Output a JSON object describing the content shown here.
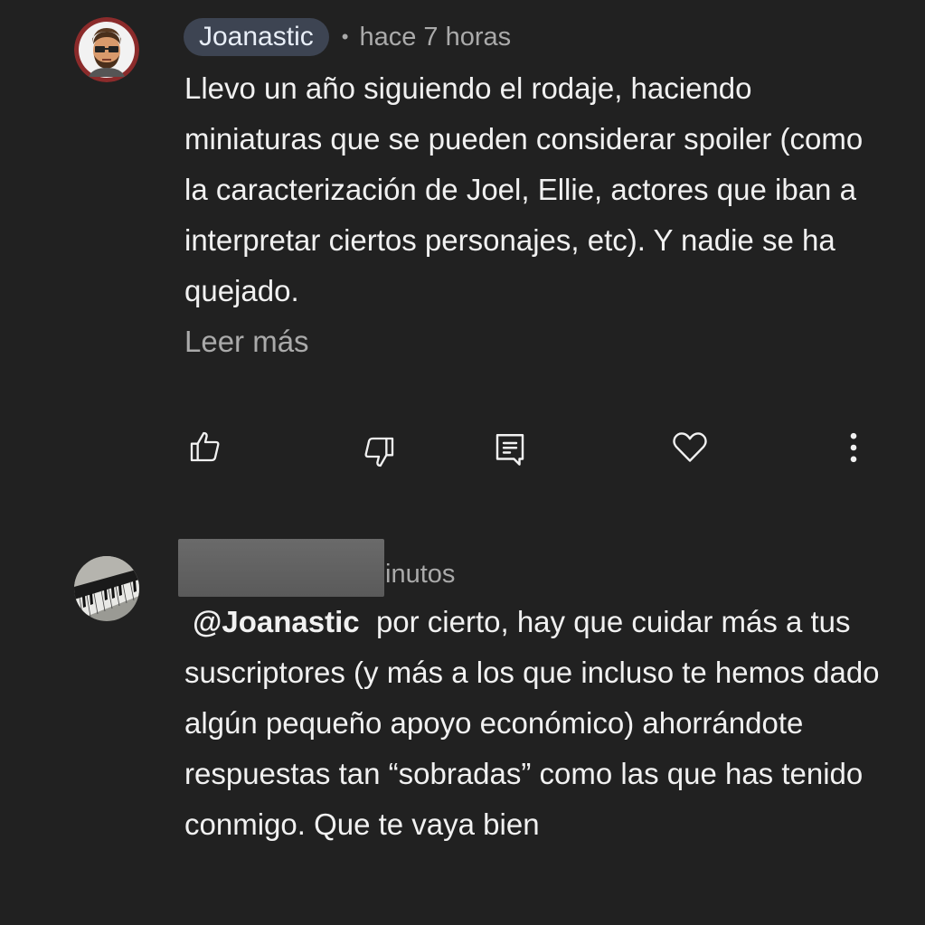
{
  "comments": [
    {
      "author": "Joanastic",
      "time": "hace 7 horas",
      "text": "Llevo un año siguiendo el rodaje, haciendo miniaturas que se pueden considerar spoiler (como la caracterización de Joel, Ellie, actores que iban a interpretar ciertos personajes, etc). Y nadie se ha quejado.",
      "read_more": "Leer más",
      "actions": {
        "like_icon": "thumbs-up-icon",
        "dislike_icon": "thumbs-down-icon",
        "reply_icon": "reply-icon",
        "heart_icon": "heart-icon",
        "more_icon": "more-vertical-icon"
      }
    },
    {
      "time_partial": "inutos",
      "mention": "@Joanastic",
      "text": "por cierto, hay que cuidar más a tus suscriptores (y más a los que incluso te hemos dado algún pequeño apoyo económico) ahorrándote respuestas tan “sobradas” como las que has tenido conmigo. Que te vaya bien"
    }
  ]
}
